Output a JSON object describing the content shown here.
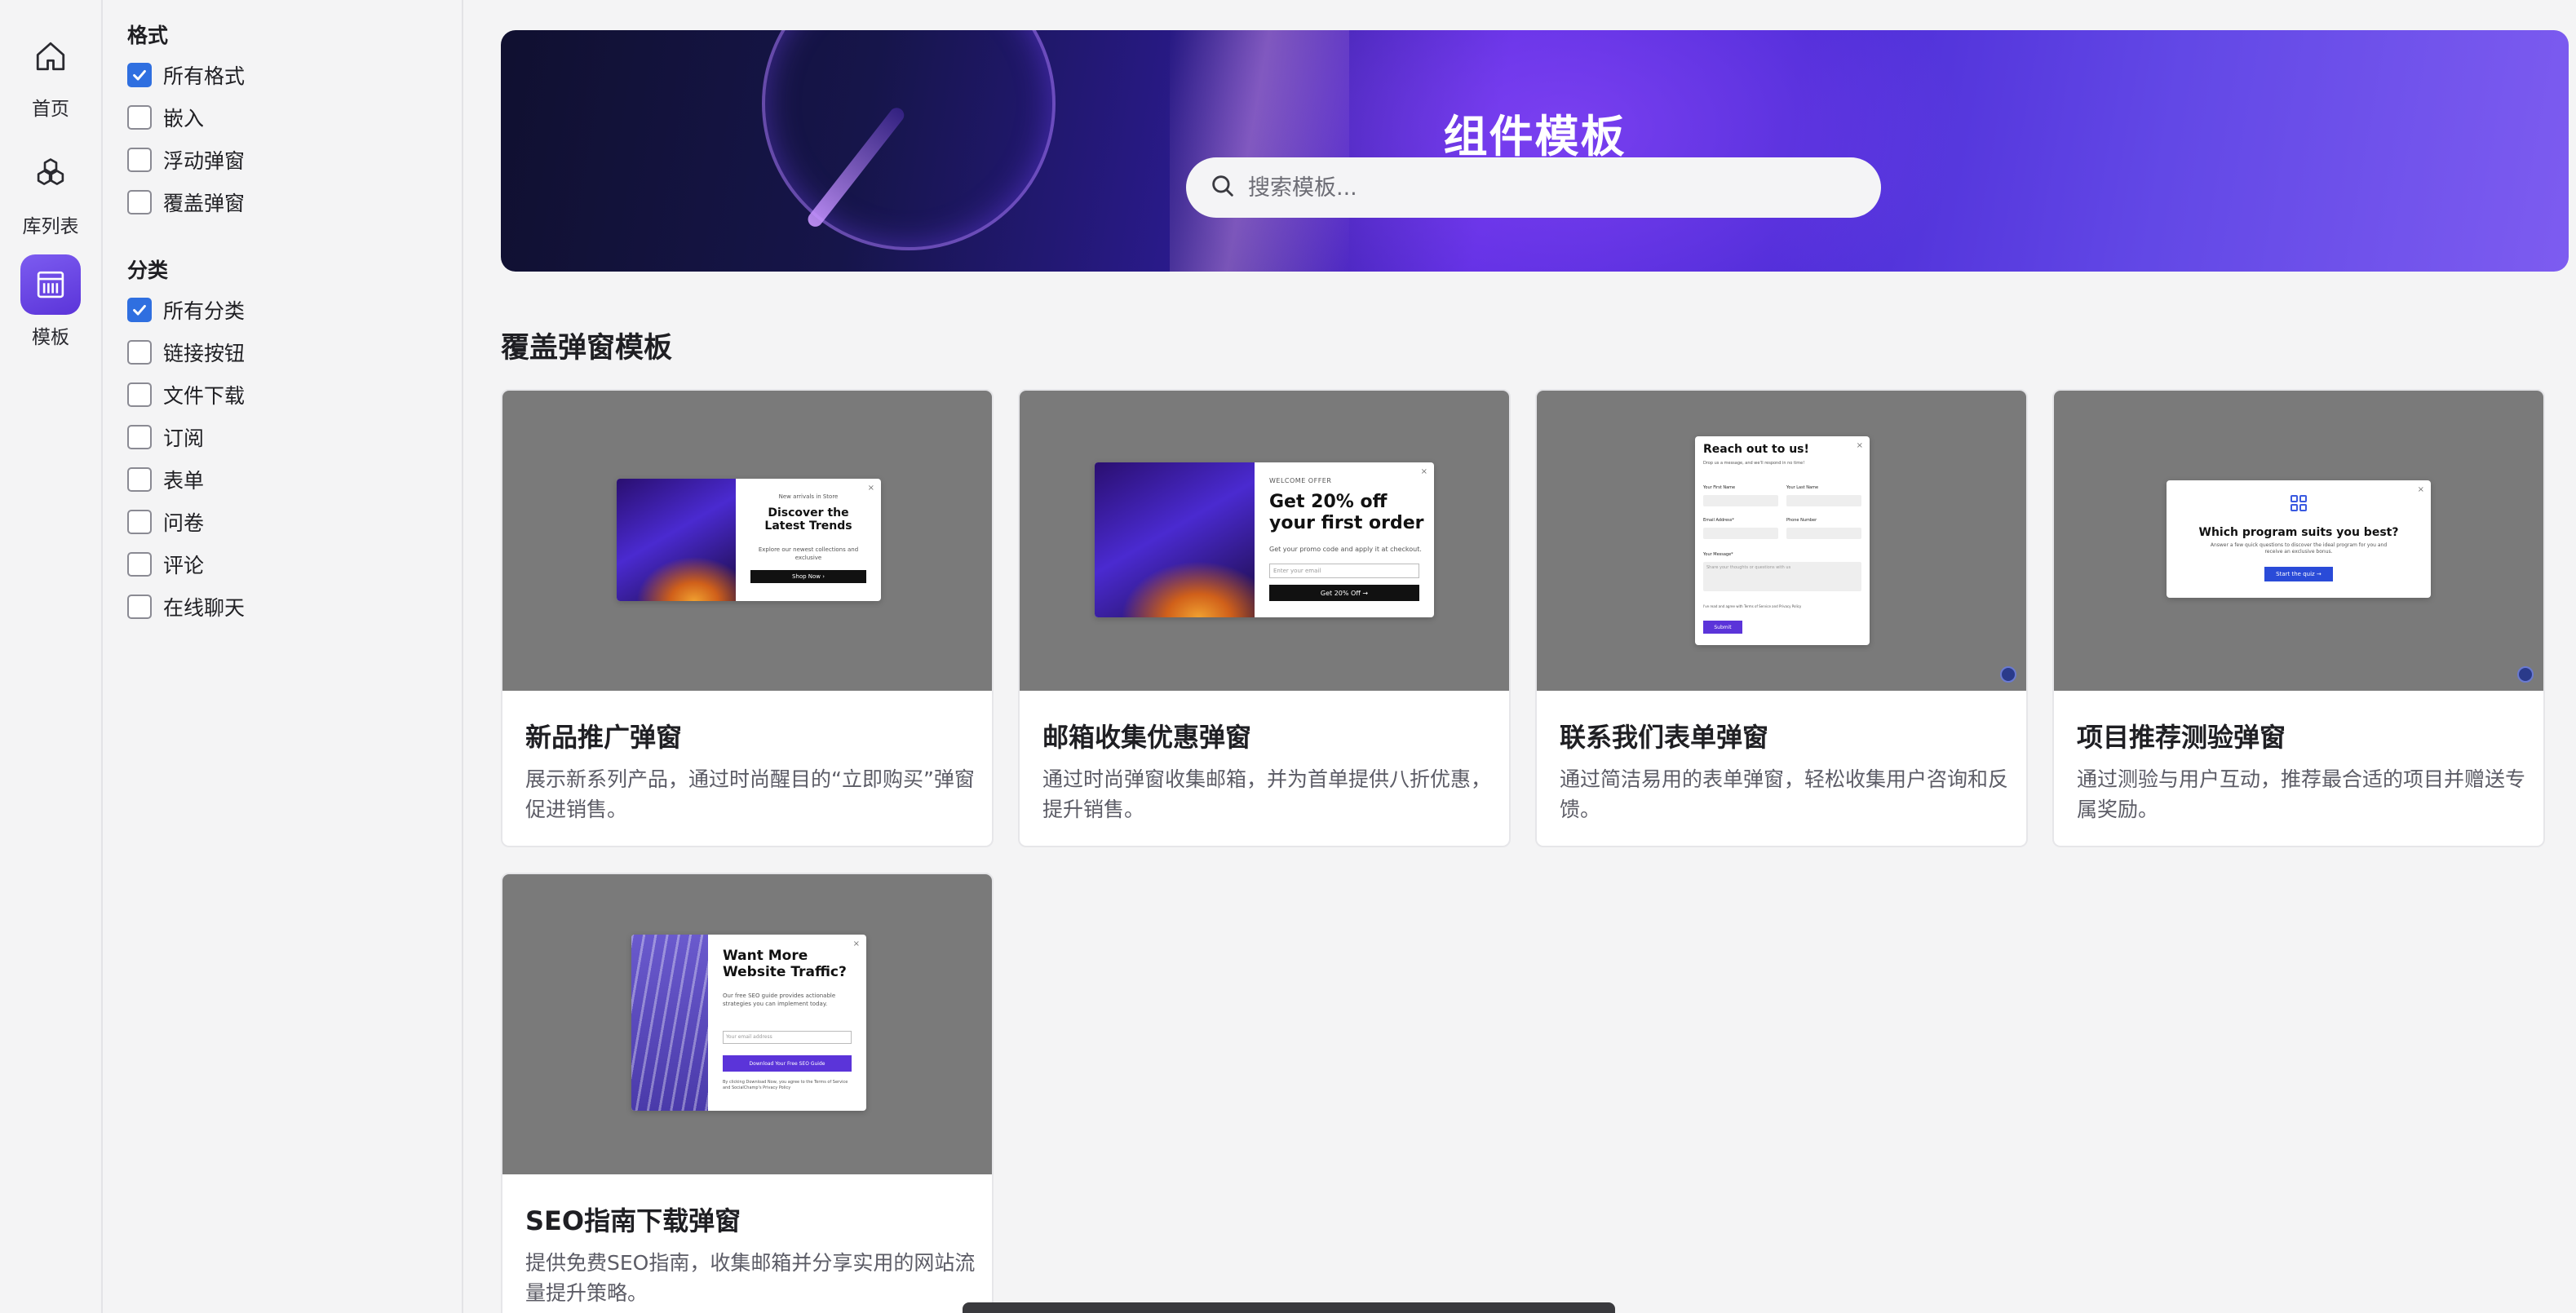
{
  "rail": {
    "items": [
      {
        "label": "首页",
        "icon": "home-icon"
      },
      {
        "label": "库列表",
        "icon": "cubes-icon"
      },
      {
        "label": "模板",
        "icon": "template-icon",
        "active": true
      }
    ]
  },
  "filters": {
    "format_title": "格式",
    "formats": [
      {
        "label": "所有格式",
        "checked": true
      },
      {
        "label": "嵌入",
        "checked": false
      },
      {
        "label": "浮动弹窗",
        "checked": false
      },
      {
        "label": "覆盖弹窗",
        "checked": false
      }
    ],
    "category_title": "分类",
    "categories": [
      {
        "label": "所有分类",
        "checked": true
      },
      {
        "label": "链接按钮",
        "checked": false
      },
      {
        "label": "文件下载",
        "checked": false
      },
      {
        "label": "订阅",
        "checked": false
      },
      {
        "label": "表单",
        "checked": false
      },
      {
        "label": "问卷",
        "checked": false
      },
      {
        "label": "评论",
        "checked": false
      },
      {
        "label": "在线聊天",
        "checked": false
      }
    ]
  },
  "hero": {
    "title": "组件模板",
    "search_placeholder": "搜索模板..."
  },
  "section": {
    "title": "覆盖弹窗模板"
  },
  "cards": [
    {
      "title": "新品推广弹窗",
      "desc": "展示新系列产品，通过时尚醒目的“立即购买”弹窗促进销售。",
      "preview": {
        "kicker": "New arrivals in Store",
        "headline": "Discover the Latest Trends",
        "body": "Explore our newest collections and exclusive",
        "button": "Shop Now  ›"
      }
    },
    {
      "title": "邮箱收集优惠弹窗",
      "desc": "通过时尚弹窗收集邮箱，并为首单提供八折优惠，提升销售。",
      "preview": {
        "kicker": "WELCOME OFFER",
        "headline": "Get 20% off your first order",
        "body": "Get your promo code and apply it at checkout.",
        "input": "Enter your email",
        "button": "Get 20% Off  →"
      }
    },
    {
      "title": "联系我们表单弹窗",
      "desc": "通过简洁易用的表单弹窗，轻松收集用户咨询和反馈。",
      "preview": {
        "headline": "Reach out to us!",
        "body": "Drop us a message, and we'll respond in no time!",
        "first_name": "Your First Name",
        "last_name": "Your Last Name",
        "email": "Email Address*",
        "phone": "Phone Number",
        "message": "Your Message*",
        "message_placeholder": "Share your thoughts or questions with us",
        "consent": "I've read and agree with Terms of Service and Privacy Policy",
        "button": "Submit"
      }
    },
    {
      "title": "项目推荐测验弹窗",
      "desc": "通过测验与用户互动，推荐最合适的项目并赠送专属奖励。",
      "preview": {
        "headline": "Which program suits you best?",
        "body": "Answer a few quick questions to discover the ideal program for you and receive an exclusive bonus.",
        "button": "Start the quiz  →"
      }
    },
    {
      "title": "SEO指南下载弹窗",
      "desc": "提供免费SEO指南，收集邮箱并分享实用的网站流量提升策略。",
      "preview": {
        "headline": "Want More Website Traffic?",
        "body": "Our free SEO guide provides actionable strategies you can implement today.",
        "input": "Your email address",
        "button": "Download Your Free SEO Guide",
        "legal": "By clicking Download Now, you agree to the Terms of Service and SocialChamp's Privacy Policy"
      }
    }
  ],
  "colors": {
    "accent": "#5b34d9",
    "checkbox": "#2f6fe0",
    "preview_bg": "#7a7a7a"
  }
}
